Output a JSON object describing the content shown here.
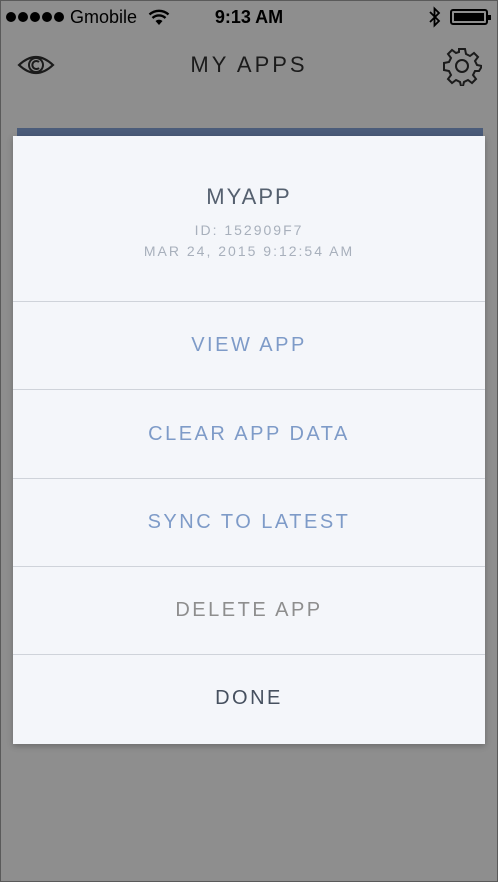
{
  "status_bar": {
    "carrier": "Gmobile",
    "time": "9:13 AM"
  },
  "nav": {
    "title": "MY APPS",
    "left_icon": "eye-icon",
    "right_icon": "gear-icon"
  },
  "sheet": {
    "app_name": "MYAPP",
    "app_id": "ID: 152909F7",
    "app_date": "MAR 24, 2015 9:12:54 AM",
    "actions": [
      {
        "label": "VIEW APP"
      },
      {
        "label": "CLEAR APP DATA"
      },
      {
        "label": "SYNC TO LATEST"
      },
      {
        "label": "DELETE APP"
      },
      {
        "label": "DONE"
      }
    ]
  },
  "colors": {
    "overlay": "#8e8e8e",
    "sheet_bg": "#f4f6fa",
    "action_blue": "#7e9bc8",
    "action_gray": "#8e8e8e",
    "done_text": "#46505f"
  }
}
